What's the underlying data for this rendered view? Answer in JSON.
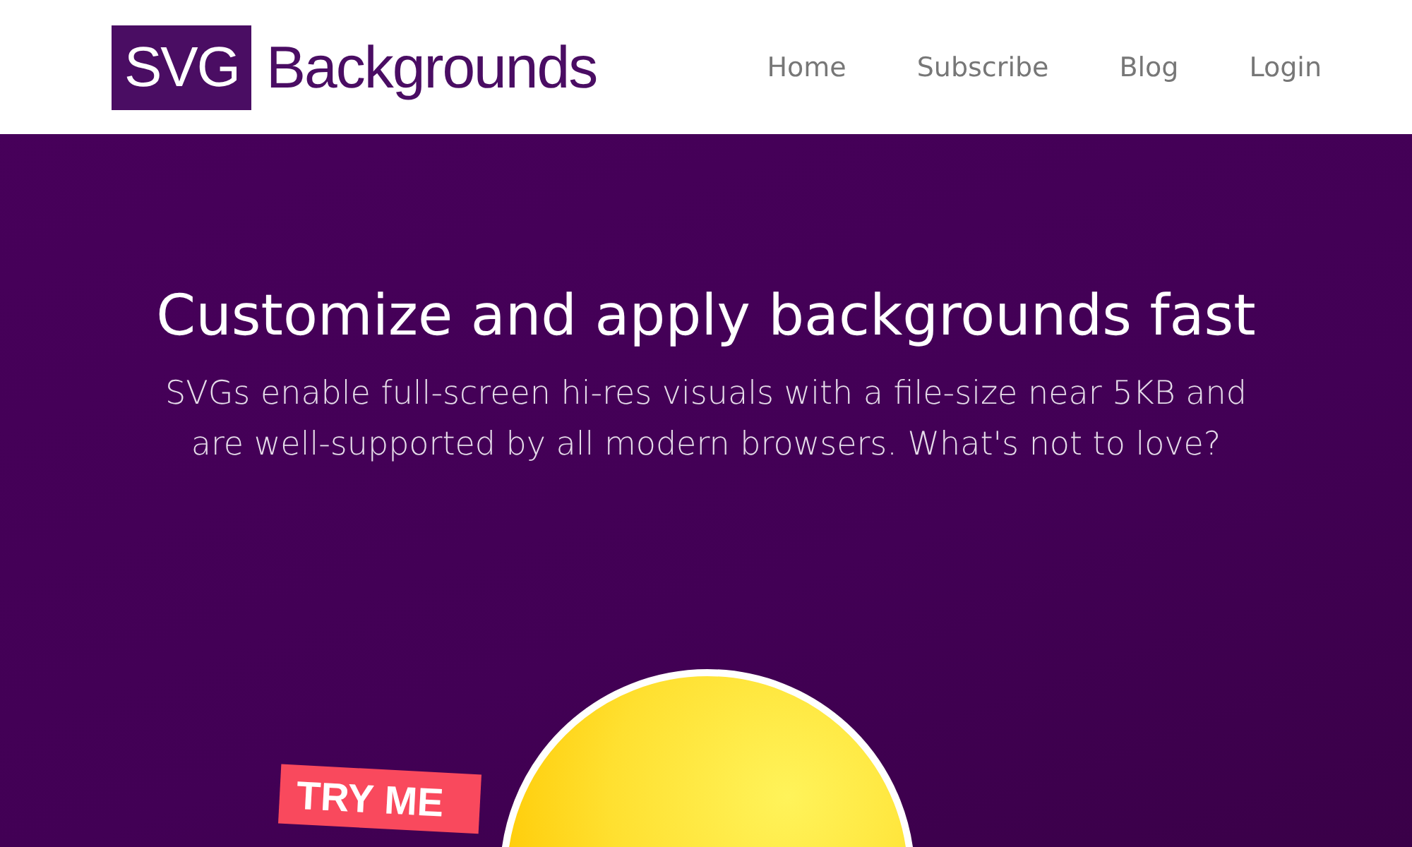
{
  "logo": {
    "mark": "SVG",
    "wordmark": "Backgrounds"
  },
  "nav": [
    {
      "label": "Home"
    },
    {
      "label": "Subscribe"
    },
    {
      "label": "Blog"
    },
    {
      "label": "Login"
    }
  ],
  "hero": {
    "title": "Customize and apply backgrounds fast",
    "subtitle": "SVGs enable full-screen hi-res visuals with a file-size near 5KB and are well-supported by all modern browsers. What's not to love?"
  },
  "demo": {
    "tag": "TRY ME"
  }
}
